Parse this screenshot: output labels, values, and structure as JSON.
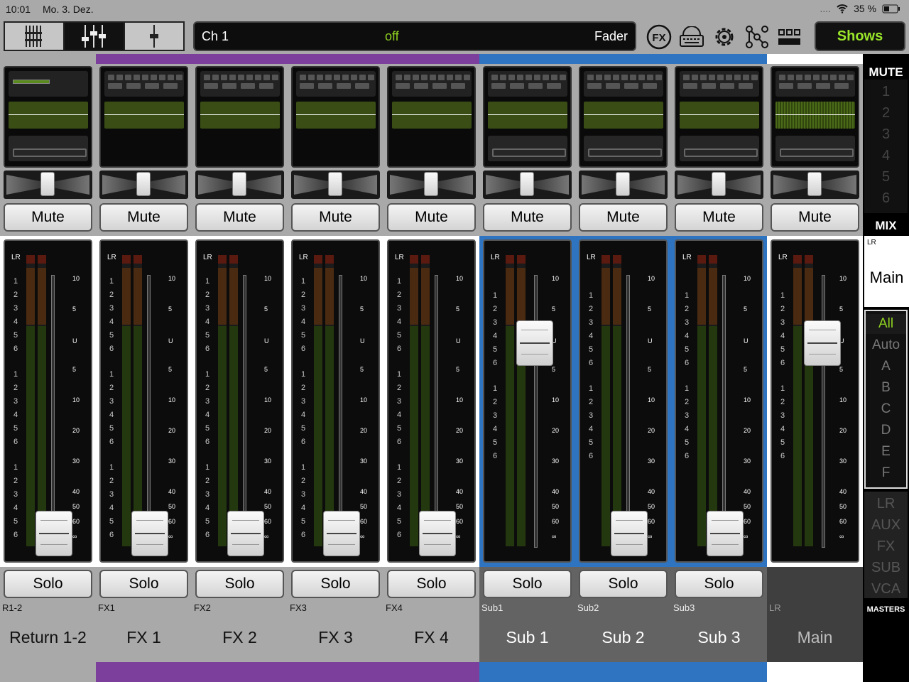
{
  "status": {
    "time": "10:01",
    "date": "Mo. 3. Dez.",
    "signal": "....",
    "battery": "35 %"
  },
  "toolbar": {
    "view_icons": [
      "mixer-view-icon",
      "channel-view-icon",
      "single-fader-icon"
    ],
    "channel": {
      "name": "Ch 1",
      "value": "off",
      "mode": "Fader"
    },
    "fx_label": "FX",
    "shows_label": "Shows"
  },
  "colors": {
    "purple": "#7c3f9c",
    "blue": "#2f74c0",
    "white": "#ffffff",
    "grey": "#a9a9a9",
    "accent_green": "#8fd121"
  },
  "strips": [
    {
      "id": "R1-2",
      "name": "Return 1-2",
      "color": "#a9a9a9",
      "style": "light",
      "mute": "Mute",
      "solo": "Solo",
      "fader_db": "-inf"
    },
    {
      "id": "FX1",
      "name": "FX 1",
      "color": "#7c3f9c",
      "style": "light",
      "mute": "Mute",
      "solo": "Solo",
      "fader_db": "-inf"
    },
    {
      "id": "FX2",
      "name": "FX 2",
      "color": "#7c3f9c",
      "style": "light",
      "mute": "Mute",
      "solo": "Solo",
      "fader_db": "-inf"
    },
    {
      "id": "FX3",
      "name": "FX 3",
      "color": "#7c3f9c",
      "style": "light",
      "mute": "Mute",
      "solo": "Solo",
      "fader_db": "-inf"
    },
    {
      "id": "FX4",
      "name": "FX 4",
      "color": "#7c3f9c",
      "style": "light",
      "mute": "Mute",
      "solo": "Solo",
      "fader_db": "-inf"
    },
    {
      "id": "Sub1",
      "name": "Sub 1",
      "color": "#2f74c0",
      "style": "dark",
      "mute": "Mute",
      "solo": "Solo",
      "fader_db": "0"
    },
    {
      "id": "Sub2",
      "name": "Sub 2",
      "color": "#2f74c0",
      "style": "dark",
      "mute": "Mute",
      "solo": "Solo",
      "fader_db": "-inf"
    },
    {
      "id": "Sub3",
      "name": "Sub 3",
      "color": "#2f74c0",
      "style": "dark",
      "mute": "Mute",
      "solo": "Solo",
      "fader_db": "-inf"
    },
    {
      "id": "LR",
      "name": "Main",
      "color": "#ffffff",
      "style": "master",
      "mute": "Mute",
      "solo": "",
      "fader_db": "0"
    }
  ],
  "meter_scale": [
    "10",
    "5",
    "U",
    "5",
    "10",
    "20",
    "30",
    "40",
    "50",
    "60",
    "∞"
  ],
  "meter_numbers": [
    "1",
    "2",
    "3",
    "4",
    "5",
    "6"
  ],
  "meter_label": "LR",
  "sidebar": {
    "mute_title": "MUTE",
    "mute_groups": [
      "1",
      "2",
      "3",
      "4",
      "5",
      "6"
    ],
    "mix_title": "MIX",
    "mix_bus_small": "LR",
    "mix_bus": "Main",
    "view_groups": [
      "All",
      "Auto",
      "A",
      "B",
      "C",
      "D",
      "E",
      "F"
    ],
    "active_view_group": "All",
    "masters": [
      "LR",
      "AUX",
      "FX",
      "SUB",
      "VCA"
    ],
    "masters_title": "MASTERS"
  }
}
